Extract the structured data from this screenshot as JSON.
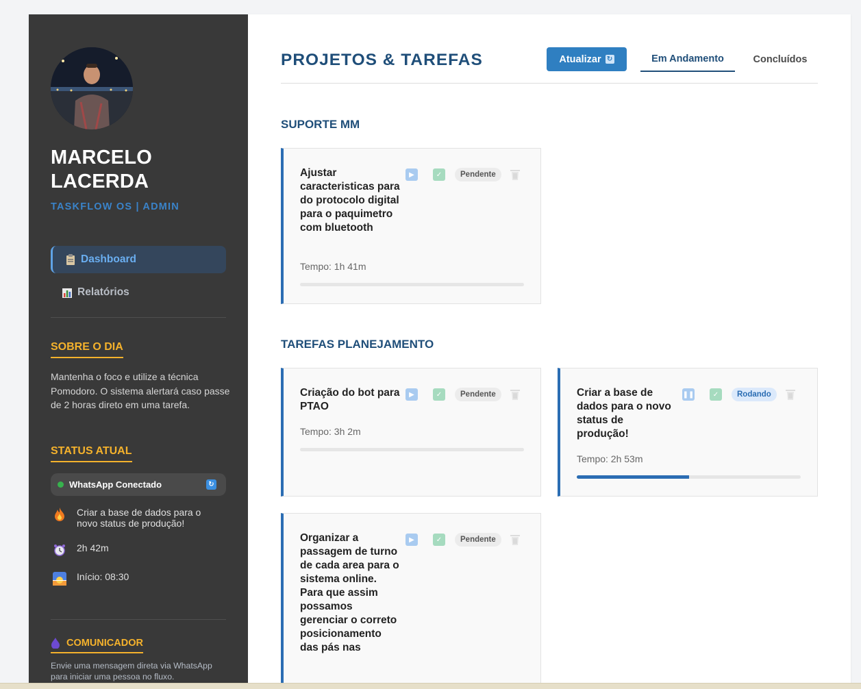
{
  "user": {
    "name": "MARCELO LACERDA",
    "role": "TASKFLOW OS | ADMIN"
  },
  "nav": {
    "items": [
      {
        "label": "Dashboard",
        "icon": "clipboard-icon",
        "active": true
      },
      {
        "label": "Relatórios",
        "icon": "bar-chart-icon",
        "active": false
      }
    ]
  },
  "about": {
    "heading": "SOBRE O DIA",
    "text": "Mantenha o foco e utilize a técnica Pomodoro. O sistema alertará caso passe de 2 horas direto em uma tarefa."
  },
  "status": {
    "heading": "STATUS ATUAL",
    "whatsapp_label": "WhatsApp Conectado",
    "current_task": "Criar a base de dados para o novo status de produção!",
    "elapsed": "2h 42m",
    "start": "Início: 08:30"
  },
  "communicator": {
    "heading": "COMUNICADOR",
    "text": "Envie uma mensagem direta via WhatsApp para iniciar uma pessoa no fluxo."
  },
  "header": {
    "title": "PROJETOS & TAREFAS",
    "refresh_label": "Atualizar",
    "tabs": [
      {
        "label": "Em Andamento",
        "active": true
      },
      {
        "label": "Concluídos",
        "active": false
      }
    ]
  },
  "groups": [
    {
      "title": "SUPORTE MM",
      "tasks": [
        {
          "title": "Ajustar caracteristicas para do protocolo digital para o paquimetro com bluetooth",
          "time": "Tempo: 1h 41m",
          "status": "Pendente",
          "progress": 0
        }
      ]
    },
    {
      "title": "TAREFAS PLANEJAMENTO",
      "tasks": [
        {
          "title": "Criação do bot para PTAO",
          "time": "Tempo: 3h 2m",
          "status": "Pendente",
          "progress": 0
        },
        {
          "title": "Criar a base de dados para o novo status de produção!",
          "time": "Tempo: 2h 53m",
          "status": "Rodando",
          "progress": 0.5
        },
        {
          "title": "Organizar a passagem de turno de cada area para o sistema online. Para que assim possamos gerenciar o correto posicionamento das pás nas",
          "time": "",
          "status": "Pendente",
          "progress": 0
        }
      ]
    }
  ],
  "colors": {
    "sidebar_bg": "#393939",
    "accent_blue": "#2b6db3",
    "accent_yellow": "#f5b22c",
    "title_blue": "#1f4e79"
  }
}
